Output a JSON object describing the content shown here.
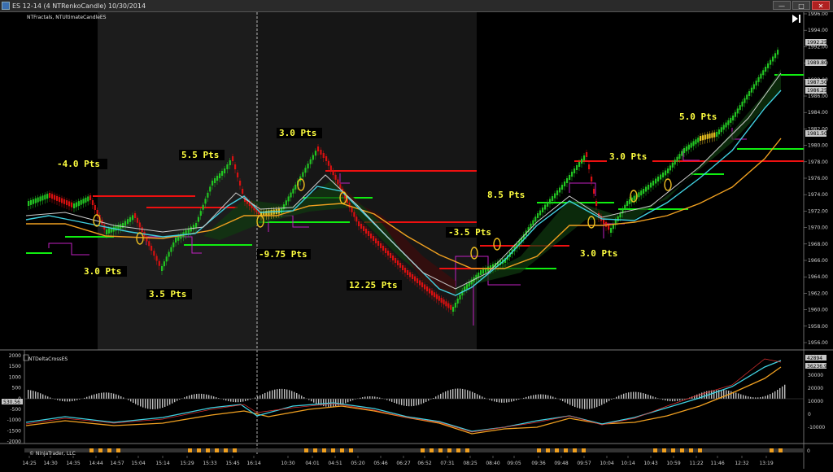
{
  "window": {
    "title": "ES 12-14 (4 NTRenkoCandle)  10/30/2014",
    "buttons": [
      "—",
      "□",
      "✕"
    ]
  },
  "price_panel": {
    "indicator_label": "NTFractals, NTUltimateCandleES",
    "play_icon": "play-end-icon",
    "y_ticks": [
      "1996.00",
      "1994.00",
      "1992.00",
      "1990.00",
      "1988.00",
      "1986.00",
      "1984.00",
      "1982.00",
      "1980.00",
      "1978.00",
      "1976.00",
      "1974.00",
      "1972.00",
      "1970.00",
      "1968.00",
      "1966.00",
      "1964.00",
      "1962.00",
      "1960.00",
      "1958.00",
      "1956.00"
    ],
    "price_tags": [
      "1992.25",
      "1989.80",
      "1987.50",
      "1986.25",
      "1981.50"
    ],
    "annotations": [
      "-4.0 Pts",
      "5.5 Pts",
      "3.0 Pts",
      "3.0 Pts",
      "3.5 Pts",
      "-9.75 Pts",
      "12.25 Pts",
      "-3.5 Pts",
      "8.5 Pts",
      "3.0 Pts",
      "3.0 Pts",
      "5.0 Pts"
    ]
  },
  "oscillator_panel": {
    "indicator_label": "NTDeltaCrossES",
    "y_ticks_left": [
      "2000",
      "1500",
      "1000",
      "500",
      "0",
      "-500",
      "-1000",
      "-1500",
      "-2000"
    ],
    "y_ticks_right": [
      "30000",
      "20000",
      "10000",
      "0",
      "-10000"
    ],
    "value_tags": [
      "42894",
      "36236.98"
    ],
    "left_tag": "530.56"
  },
  "footer": {
    "copyright": "© NinjaTrader, LLC",
    "right_tick": "0"
  },
  "x_ticks": [
    "14:25",
    "14:30",
    "14:35",
    "14:44",
    "14:57",
    "15:04",
    "15:14",
    "15:29",
    "15:33",
    "15:45",
    "16:14",
    "10:30",
    "04:01",
    "04:51",
    "05:20",
    "05:46",
    "06:27",
    "06:52",
    "07:31",
    "08:25",
    "08:40",
    "09:05",
    "09:36",
    "09:48",
    "09:57",
    "10:04",
    "10:14",
    "10:43",
    "10:59",
    "11:22",
    "11:46",
    "12:32",
    "13:19"
  ],
  "colors": {
    "background": "#000000",
    "session_shade": "#1c1c1c",
    "bull_candle": "#22c422",
    "bear_candle": "#d81010",
    "transition_candle": "#e8c020",
    "fast_ma": "#40d0e0",
    "slow_ma": "#f0a020",
    "mid_ma": "#cccccc",
    "fractal_step": "#c020c0",
    "resistance": "#ee1010",
    "support": "#10ee10",
    "annotation_text": "#ffff40"
  }
}
